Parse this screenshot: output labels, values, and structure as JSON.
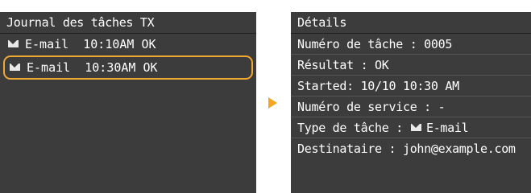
{
  "left_panel": {
    "title": "Journal des tâches TX",
    "items": [
      {
        "icon": "envelope-icon",
        "type": "E-mail",
        "time": "10:10AM",
        "status": "OK",
        "selected": false
      },
      {
        "icon": "envelope-icon",
        "type": "E-mail",
        "time": "10:30AM",
        "status": "OK",
        "selected": true
      }
    ]
  },
  "right_panel": {
    "title": "Détails",
    "job_number": "Numéro de tâche : 0005",
    "result": "Résultat : OK",
    "started": "Started: 10/10 10:30 AM",
    "service_number": "Numéro de service : -",
    "job_type_label": "Type de tâche :",
    "job_type_value": "E-mail",
    "recipient": "Destinataire : john@example.com"
  },
  "colors": {
    "panel_bg": "#3c3c3c",
    "selection_border": "#f0a830",
    "arrow": "#f5a623",
    "text": "#ffffff"
  }
}
